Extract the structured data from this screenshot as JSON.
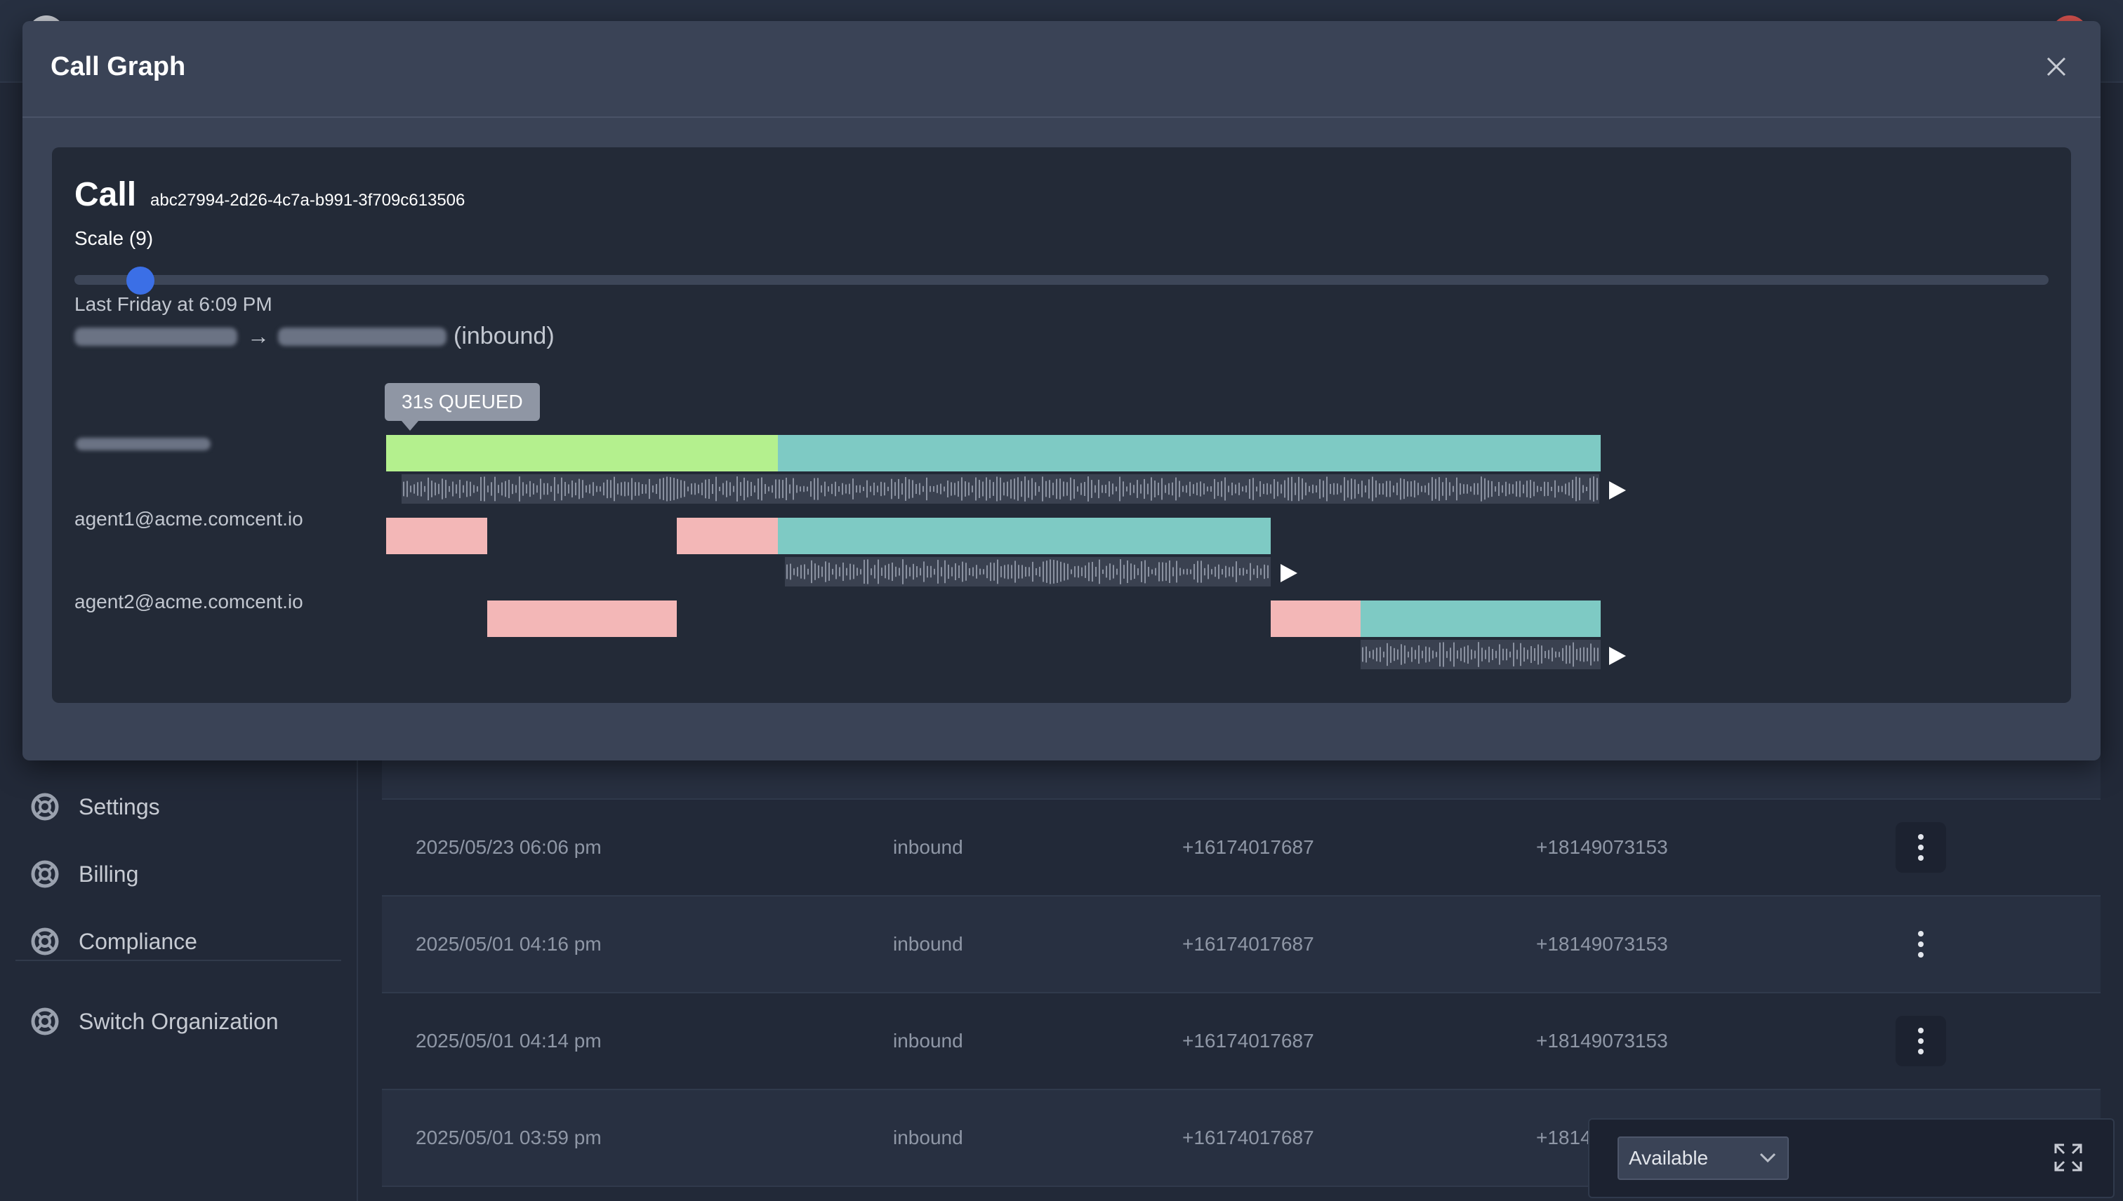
{
  "sidebar": {
    "items": [
      {
        "label": "Settings",
        "icon": "lifebuoy-icon"
      },
      {
        "label": "Billing",
        "icon": "lifebuoy-icon"
      },
      {
        "label": "Compliance",
        "icon": "lifebuoy-icon"
      },
      {
        "label": "Switch Organization",
        "icon": "lifebuoy-icon"
      }
    ]
  },
  "table": {
    "rows": [
      {
        "date": "2025/05/23 06:06 pm",
        "direction": "inbound",
        "from": "+16174017687",
        "to": "+18149073153"
      },
      {
        "date": "2025/05/01 04:16 pm",
        "direction": "inbound",
        "from": "+16174017687",
        "to": "+18149073153"
      },
      {
        "date": "2025/05/01 04:14 pm",
        "direction": "inbound",
        "from": "+16174017687",
        "to": "+18149073153"
      },
      {
        "date": "2025/05/01 03:59 pm",
        "direction": "inbound",
        "from": "+16174017687",
        "to": "+1814"
      }
    ]
  },
  "modal": {
    "title": "Call Graph",
    "call_label": "Call",
    "call_id": "abc27994-2d26-4c7a-b991-3f709c613506",
    "scale_label": "Scale (9)",
    "scale_value": 9,
    "when": "Last Friday at 6:09 PM",
    "route_arrow": "→",
    "route_direction": "(inbound)",
    "tooltip": "31s QUEUED",
    "lanes": [
      {
        "label": ""
      },
      {
        "label": "agent1@acme.comcent.io"
      },
      {
        "label": "agent2@acme.comcent.io"
      }
    ]
  },
  "status": {
    "selected": "Available",
    "options": [
      "Available"
    ]
  },
  "colors": {
    "queued": "#b4f08e",
    "connected": "#7ecac4",
    "ringing": "#f3b7b7",
    "slider_thumb": "#3b6fe6"
  }
}
